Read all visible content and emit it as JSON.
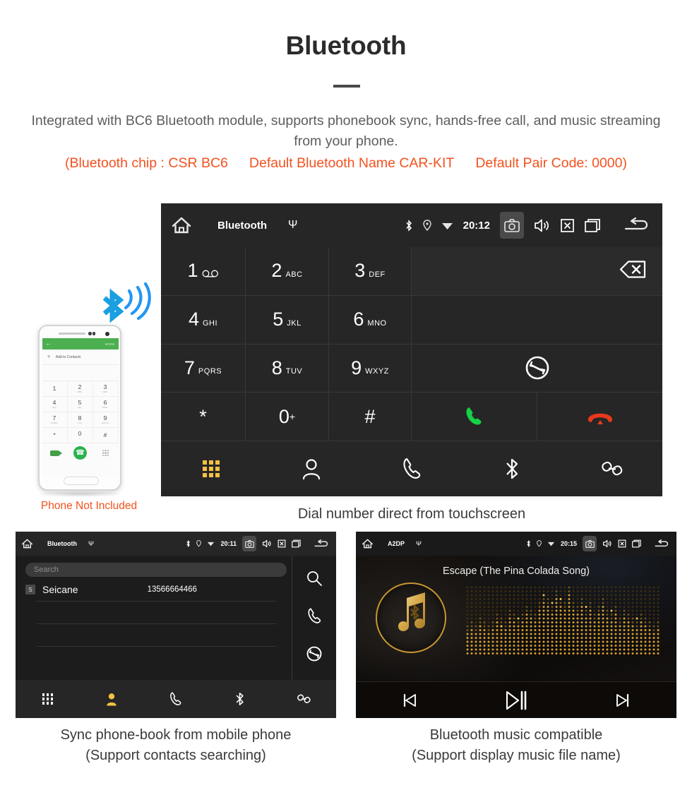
{
  "header": {
    "title": "Bluetooth",
    "description": "Integrated with BC6 Bluetooth module, supports phonebook sync, hands-free call, and music streaming from your phone.",
    "spec_chip": "(Bluetooth chip : CSR BC6",
    "spec_name": "Default Bluetooth Name CAR-KIT",
    "spec_pair": "Default Pair Code: 0000)",
    "accent_color": "#f4511e",
    "text_color": "#5d5d5d"
  },
  "phone_illustration": {
    "bluetooth_icon": "bluetooth-wireless-icon",
    "screen": {
      "more_label": "MORE",
      "add_to_contacts": "Add to Contacts",
      "keys": [
        {
          "digit": "1",
          "letters": ""
        },
        {
          "digit": "2",
          "letters": "ABC"
        },
        {
          "digit": "3",
          "letters": "DEF"
        },
        {
          "digit": "4",
          "letters": "GHI"
        },
        {
          "digit": "5",
          "letters": "JKL"
        },
        {
          "digit": "6",
          "letters": "MNO"
        },
        {
          "digit": "7",
          "letters": "PQRS"
        },
        {
          "digit": "8",
          "letters": "TUV"
        },
        {
          "digit": "9",
          "letters": "WXYZ"
        },
        {
          "digit": "*",
          "letters": ""
        },
        {
          "digit": "0",
          "letters": "+"
        },
        {
          "digit": "#",
          "letters": ""
        }
      ]
    },
    "caption": "Phone Not Included"
  },
  "dial_screen": {
    "status": {
      "home_icon": "home-icon",
      "title": "Bluetooth",
      "usb_icon": "usb-icon",
      "bluetooth_icon": "bluetooth-icon",
      "location_icon": "location-icon",
      "wifi_icon": "wifi-icon",
      "time": "20:12",
      "camera_icon": "camera-icon",
      "volume_icon": "volume-icon",
      "mute_icon": "mute-icon",
      "recents_icon": "recents-icon",
      "back_icon": "back-icon"
    },
    "keys": [
      {
        "digit": "1",
        "letters": "",
        "voicemail": true
      },
      {
        "digit": "2",
        "letters": "ABC"
      },
      {
        "digit": "3",
        "letters": "DEF"
      },
      {
        "digit": "4",
        "letters": "GHI"
      },
      {
        "digit": "5",
        "letters": "JKL"
      },
      {
        "digit": "6",
        "letters": "MNO"
      },
      {
        "digit": "7",
        "letters": "PQRS"
      },
      {
        "digit": "8",
        "letters": "TUV"
      },
      {
        "digit": "9",
        "letters": "WXYZ"
      },
      {
        "digit": "*",
        "letters": ""
      },
      {
        "digit": "0",
        "letters": "+"
      },
      {
        "digit": "#",
        "letters": ""
      }
    ],
    "number_display": "",
    "delete_icon": "backspace-icon",
    "sync_icon": "sync-icon",
    "call_icon": "call-answer-icon",
    "hangup_icon": "call-end-icon",
    "call_color": "#15d146",
    "hangup_color": "#e8391a",
    "nav": [
      {
        "name": "dialpad",
        "icon": "dialpad-icon",
        "active": true
      },
      {
        "name": "contacts",
        "icon": "contacts-icon",
        "active": false
      },
      {
        "name": "call-log",
        "icon": "phone-icon",
        "active": false
      },
      {
        "name": "bluetooth",
        "icon": "bluetooth-icon",
        "active": false
      },
      {
        "name": "pair",
        "icon": "link-icon",
        "active": false
      }
    ],
    "active_color": "#f5c141",
    "caption": "Dial number direct from touchscreen"
  },
  "phonebook_screen": {
    "status": {
      "title": "Bluetooth",
      "time": "20:11"
    },
    "search_placeholder": "Search",
    "contacts": [
      {
        "initial": "S",
        "name": "Seicane",
        "number": "13566664466"
      }
    ],
    "side_actions": [
      {
        "name": "search",
        "icon": "search-icon"
      },
      {
        "name": "call",
        "icon": "phone-icon"
      },
      {
        "name": "sync",
        "icon": "sync-icon"
      }
    ],
    "nav": [
      {
        "name": "dialpad",
        "icon": "dialpad-icon",
        "active": false
      },
      {
        "name": "contacts",
        "icon": "contacts-icon",
        "active": true
      },
      {
        "name": "call-log",
        "icon": "phone-icon",
        "active": false
      },
      {
        "name": "bluetooth",
        "icon": "bluetooth-icon",
        "active": false
      },
      {
        "name": "pair",
        "icon": "link-icon",
        "active": false
      }
    ],
    "caption_line1": "Sync phone-book from mobile phone",
    "caption_line2": "(Support contacts searching)"
  },
  "music_screen": {
    "status": {
      "title": "A2DP",
      "time": "20:15"
    },
    "track_title": "Escape (The Pina Colada Song)",
    "album_icon": "music-note-bluetooth-icon",
    "controls": [
      {
        "name": "previous",
        "icon": "skip-previous-icon"
      },
      {
        "name": "play-pause",
        "icon": "play-pause-icon"
      },
      {
        "name": "next",
        "icon": "skip-next-icon"
      }
    ],
    "accent_color": "#c9962f",
    "caption_line1": "Bluetooth music compatible",
    "caption_line2": "(Support display music file name)"
  }
}
